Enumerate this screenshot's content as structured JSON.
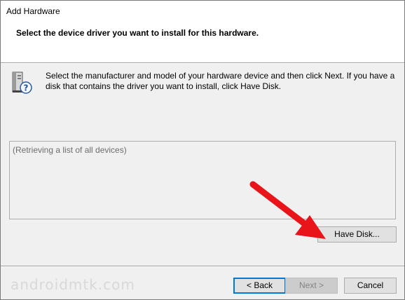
{
  "window": {
    "title": "Add Hardware"
  },
  "header": {
    "heading": "Select the device driver you want to install for this hardware."
  },
  "instructions": {
    "icon": "hardware-device-question-icon",
    "text": "Select the manufacturer and model of your hardware device and then click Next. If you have a disk that contains the driver you want to install, click Have Disk."
  },
  "device_list": {
    "status": "(Retrieving a list of all devices)"
  },
  "buttons": {
    "have_disk": "Have Disk...",
    "back": "< Back",
    "next": "Next >",
    "cancel": "Cancel"
  },
  "annotation": {
    "arrow_color": "#e8141a"
  },
  "watermark": {
    "text": "androidmtk.com"
  }
}
